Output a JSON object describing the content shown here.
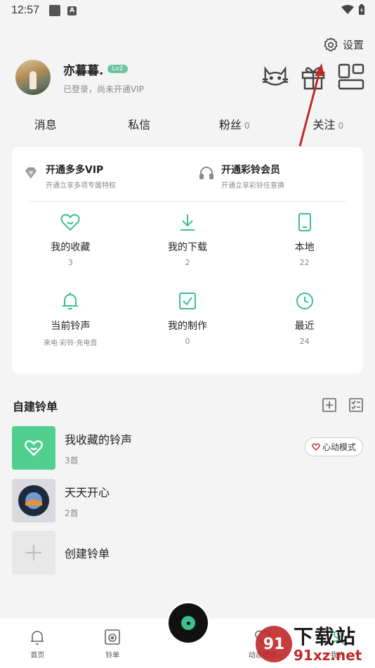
{
  "status": {
    "time": "12:57",
    "a_badge": "A"
  },
  "settings": {
    "label": "设置",
    "icon": "gear-icon"
  },
  "profile": {
    "name": "亦暮暮.",
    "level": "Lv2",
    "status": "已登录，尚未开通VIP"
  },
  "top_icons": [
    "cat-icon",
    "gift-icon",
    "grid-icon"
  ],
  "social": [
    {
      "label": "消息",
      "count": ""
    },
    {
      "label": "私信",
      "count": ""
    },
    {
      "label": "粉丝",
      "count": "0"
    },
    {
      "label": "关注",
      "count": "0"
    }
  ],
  "vip": [
    {
      "title": "开通多多VIP",
      "sub": "开通立享多项专属特权",
      "icon": "diamond-icon"
    },
    {
      "title": "开通彩铃会员",
      "sub": "开通立享彩铃任意换",
      "icon": "headphone-icon"
    }
  ],
  "grid": [
    {
      "label": "我的收藏",
      "count": "3",
      "icon": "heart-icon"
    },
    {
      "label": "我的下载",
      "count": "2",
      "icon": "download-icon"
    },
    {
      "label": "本地",
      "count": "22",
      "icon": "phone-icon"
    },
    {
      "label": "当前铃声",
      "count": "来电·彩铃·充电音",
      "icon": "bell-icon"
    },
    {
      "label": "我的制作",
      "count": "0",
      "icon": "check-box-icon"
    },
    {
      "label": "最近",
      "count": "24",
      "icon": "clock-icon"
    }
  ],
  "playlists_section": {
    "title": "自建铃单"
  },
  "playlists": [
    {
      "title": "我收藏的铃声",
      "count": "3首",
      "badge": "心动模式"
    },
    {
      "title": "天天开心",
      "count": "2首"
    },
    {
      "title": "创建铃单"
    }
  ],
  "tabs": [
    {
      "label": "首页",
      "icon": "bell-tab-icon"
    },
    {
      "label": "铃单",
      "icon": "speaker-tab-icon"
    },
    {
      "label": "",
      "icon": "record-disc-icon"
    },
    {
      "label": "动态壁纸",
      "icon": "wallpaper-tab-icon"
    },
    {
      "label": "我的",
      "icon": "user-tab-icon"
    }
  ],
  "watermark": {
    "title": "下载站",
    "url": "91xz.net",
    "logo": "91"
  },
  "colors": {
    "accent": "#3cbf8c",
    "arrow": "#c0292a"
  }
}
